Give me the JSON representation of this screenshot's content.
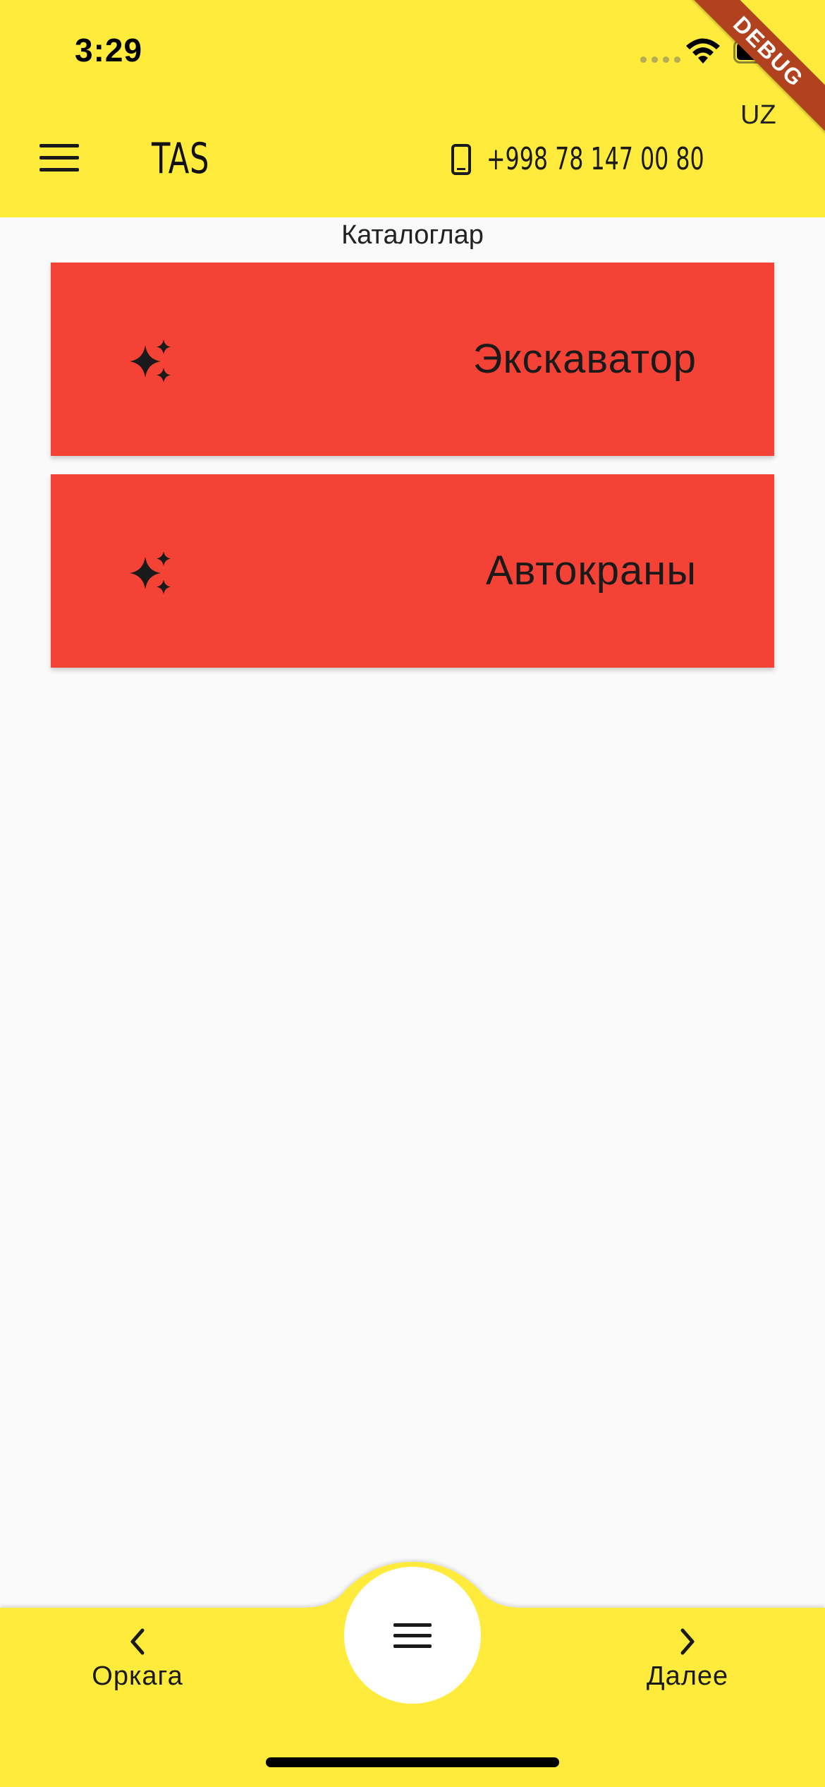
{
  "status_bar": {
    "time": "3:29"
  },
  "debug_banner": {
    "label": "DEBUG"
  },
  "app_bar": {
    "title": "TAS",
    "language": "UZ",
    "phone": "+998 78 147 00 80"
  },
  "catalog": {
    "title": "Каталоглар",
    "items": [
      {
        "label": "Экскаватор",
        "icon": "sparkles-icon"
      },
      {
        "label": "Автокраны",
        "icon": "sparkles-icon"
      }
    ]
  },
  "bottom_nav": {
    "back_label": "Оркага",
    "next_label": "Далее",
    "center_icon": "menu-icon"
  },
  "colors": {
    "app_bar": "#ffeb3b",
    "card": "#f44336",
    "background": "#fafafa",
    "debug_ribbon": "#b0421f"
  }
}
